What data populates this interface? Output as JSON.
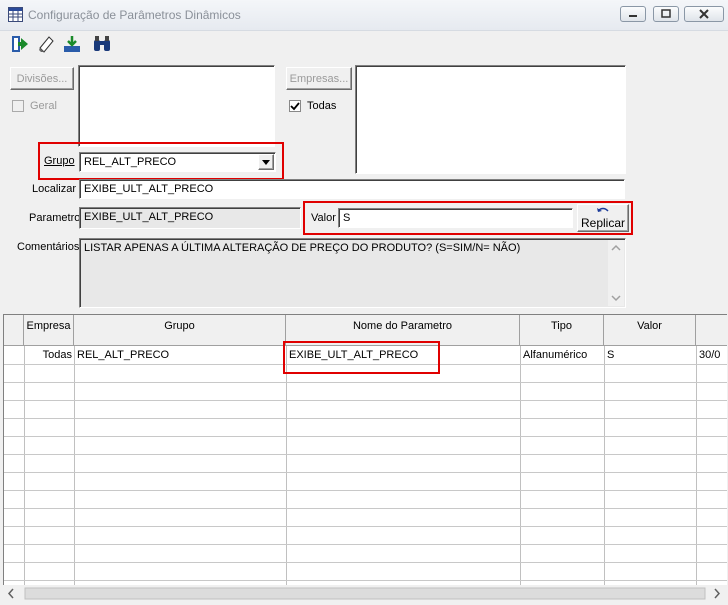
{
  "window": {
    "title": "Configuração de Parâmetros Dinâmicos"
  },
  "toolbar": {
    "icons": [
      "exit-icon",
      "eraser-icon",
      "import-icon",
      "binoculars-icon"
    ]
  },
  "filters": {
    "divisoes_button": "Divisões...",
    "geral_label": "Geral",
    "empresas_button": "Empresas...",
    "todas_label": "Todas"
  },
  "form": {
    "grupo_label": "Grupo",
    "grupo_value": "REL_ALT_PRECO",
    "localizar_label": "Localizar",
    "localizar_value": "EXIBE_ULT_ALT_PRECO",
    "parametro_label": "Parametro",
    "parametro_value": "EXIBE_ULT_ALT_PRECO",
    "valor_label": "Valor",
    "valor_value": "S",
    "replicar_button": "Replicar",
    "comentarios_label": "Comentários",
    "comentarios_value": "LISTAR APENAS A ÚLTIMA ALTERAÇÃO DE PREÇO DO PRODUTO? (S=SIM/N= NÃO)"
  },
  "grid": {
    "headers": [
      "Empresa",
      "Grupo",
      "Nome do Parametro",
      "Tipo",
      "Valor"
    ],
    "rows": [
      {
        "empresa": "Todas",
        "grupo": "REL_ALT_PRECO",
        "nome": "EXIBE_ULT_ALT_PRECO",
        "tipo": "Alfanumérico",
        "valor": "S",
        "data": "30/0"
      }
    ]
  },
  "colors": {
    "highlight": "#e00000",
    "window_bg": "#f0f0f0"
  }
}
